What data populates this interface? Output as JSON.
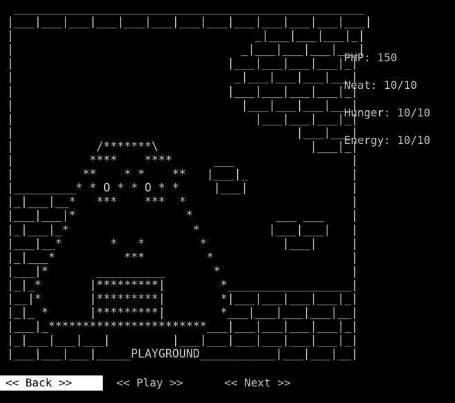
{
  "scene": {
    "art_lines": [
      " ___________________________________________________",
      "|___|___|___|___|___|___|___|___|___|___|___|___|___|",
      "|                                   _|___|___|___|_|",
      "|                                 _|___|___|___|___|",
      "|                               |___|___|___|___|_|",
      "|                                _|___|___|___|___|",
      "|                               |___|___|___|___|_|",
      "|                                 |___|___|___|___|",
      "|                                   |___|___|___|_|",
      "|                                         |___|___|",
      "|            /*******\\                      |___|_|",
      "|           ****    ****      ___                 |",
      "|          **    * *    **   |___|_               |",
      "|_________* * O * * O * *     |___|               |",
      "|_|___|__*   ***    ***  *                        |",
      "|___|___|*                *            ___ ___    |",
      "|_|___|_*                  *          |___|___|   |",
      "|___|__*       *   *        *           |___|     |",
      "|_|___*          ***         *                    |",
      "|___|*       __________       *                   |",
      "|_|_*       |*********|        *__________________|",
      "|__|*       |*********|        *|___|___|___|___|_|",
      "|_|_ *      |*********|        *___|___|___|___|__|",
      "|___|_***********************___|___|___|___|___|_|",
      "|_|___|___|___|         |___|___|___|___|___|___|_|",
      "|___|___|___|_____PLAYGROUND___________|___|___|__|"
    ]
  },
  "stats": {
    "php": "PHP: 150",
    "neat": "Neat: 10/10",
    "hunger": "Hunger: 10/10",
    "energy": "Energy: 10/10"
  },
  "menu": {
    "back": "<< Back >>",
    "play": "<< Play >>",
    "next": "<< Next >>",
    "selected": "back"
  }
}
